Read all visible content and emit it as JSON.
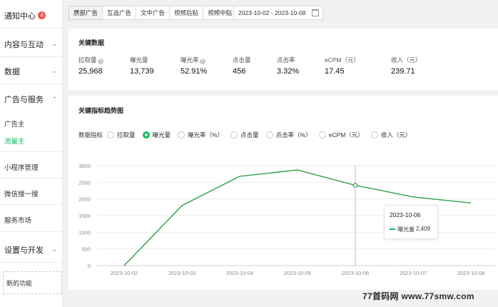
{
  "sidebar": {
    "notification": {
      "label": "通知中心",
      "count": "4"
    },
    "groups": [
      {
        "label": "内容与互动"
      },
      {
        "label": "数据"
      },
      {
        "label": "广告与服务"
      },
      {
        "label": "设置与开发"
      }
    ],
    "ad_items": [
      "广告主",
      "流量主"
    ],
    "items": [
      "小程序管理",
      "微信搜一搜",
      "服务市场"
    ],
    "new_function": "新的功能"
  },
  "toolbar": {
    "tabs": [
      "赝部广告",
      "互选广告",
      "文中广告",
      "视频后贴",
      "视频中贴"
    ],
    "date_range": "2023-10-02 - 2023-10-08"
  },
  "key_data": {
    "title": "关键数据",
    "metrics": [
      {
        "label": "拉取量",
        "value": "25,968"
      },
      {
        "label": "曝光量",
        "value": "13,739"
      },
      {
        "label": "曝光率",
        "value": "52.91%"
      },
      {
        "label": "点击量",
        "value": "456"
      },
      {
        "label": "点击率",
        "value": "3.32%"
      },
      {
        "label": "eCPM（元）",
        "value": "17.45"
      },
      {
        "label": "收入（元）",
        "value": "239.71"
      }
    ]
  },
  "trend": {
    "title": "关键指标趋势图",
    "selector_label": "数据指标",
    "options": [
      "拉取量",
      "曝光量",
      "曝光率（%）",
      "点击量",
      "点击率（%）",
      "eCPM（元）",
      "收入（元）"
    ],
    "selected": "曝光量"
  },
  "chart_data": {
    "type": "line",
    "categories": [
      "2023-10-02",
      "2023-10-03",
      "2023-10-04",
      "2023-10-05",
      "2023-10-06",
      "2023-10-07",
      "2023-10-08"
    ],
    "series": [
      {
        "name": "曝光量",
        "values": [
          0,
          1800,
          2680,
          2870,
          2409,
          2060,
          1880
        ],
        "color": "#2ea043"
      }
    ],
    "yticks": [
      "0",
      "500",
      "1000",
      "1500",
      "2000",
      "2500",
      "3000"
    ],
    "ylim": [
      0,
      3000
    ],
    "grid": true
  },
  "tooltip": {
    "date": "2023-10-06",
    "name": "曝光量",
    "value": "2,409"
  },
  "watermark": "77首码网 www.77smw.com"
}
